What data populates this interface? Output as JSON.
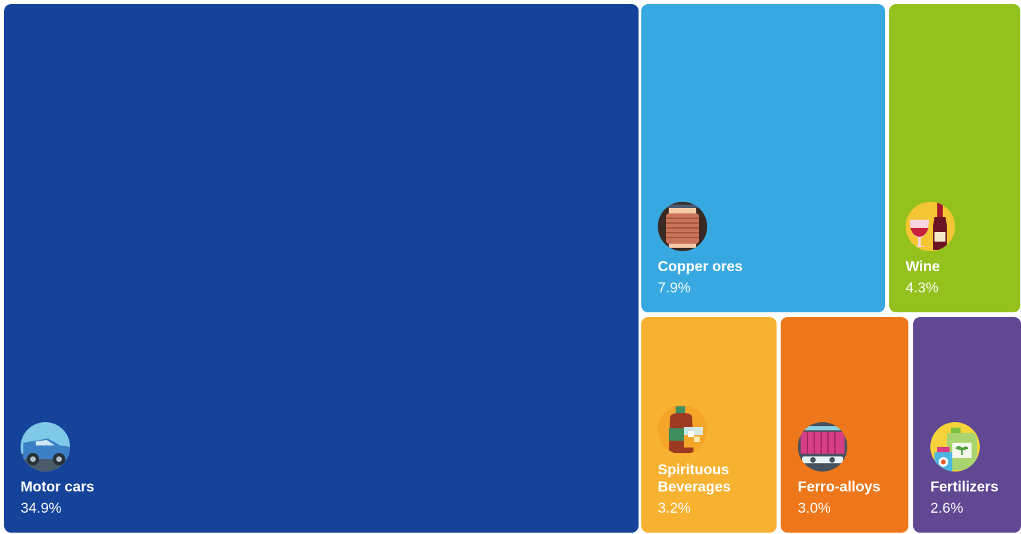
{
  "chart_data": {
    "type": "treemap",
    "items": [
      {
        "id": "motor",
        "label": "Motor cars",
        "value": 34.9,
        "value_label": "34.9%",
        "color": "#15439A",
        "icon": "car-icon"
      },
      {
        "id": "copper",
        "label": "Copper ores",
        "value": 7.9,
        "value_label": "7.9%",
        "color": "#38A9E0",
        "icon": "copper-coil-icon"
      },
      {
        "id": "wine",
        "label": "Wine",
        "value": 4.3,
        "value_label": "4.3%",
        "color": "#95C11F",
        "icon": "wine-bottle-icon"
      },
      {
        "id": "spirit",
        "label": "Spirituous Beverages",
        "value": 3.2,
        "value_label": "3.2%",
        "color": "#F7B231",
        "icon": "liquor-glass-icon"
      },
      {
        "id": "ferro",
        "label": "Ferro-alloys",
        "value": 3.0,
        "value_label": "3.0%",
        "color": "#EE771B",
        "icon": "mine-cart-icon"
      },
      {
        "id": "fert",
        "label": "Fertilizers",
        "value": 2.6,
        "value_label": "2.6%",
        "color": "#604893",
        "icon": "fertilizer-jug-icon"
      }
    ]
  }
}
